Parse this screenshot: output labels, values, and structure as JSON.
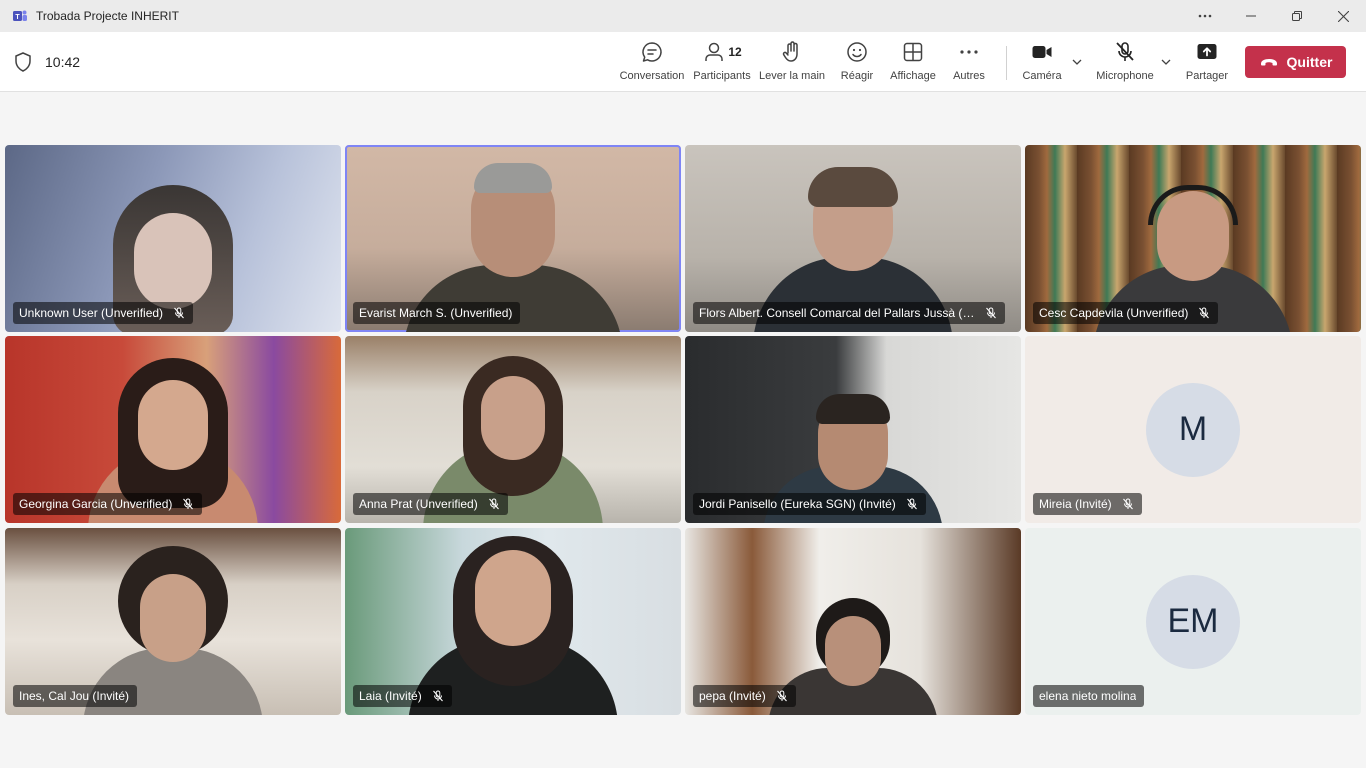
{
  "window": {
    "title": "Trobada Projecte INHERIT",
    "controls": [
      "more",
      "minimize",
      "restore",
      "close"
    ]
  },
  "toolbar": {
    "time": "10:42",
    "buttons": {
      "conversation": "Conversation",
      "participants": "Participants",
      "participants_count": "12",
      "raise_hand": "Lever la main",
      "react": "Réagir",
      "view": "Affichage",
      "more": "Autres",
      "camera": "Caméra",
      "microphone": "Microphone",
      "share": "Partager",
      "leave": "Quitter"
    }
  },
  "colors": {
    "leave_button": "#c4314b",
    "active_speaker_outline": "#7f85f5"
  },
  "participants": [
    {
      "name": "Unknown User (Unverified)",
      "muted": true,
      "video": true,
      "active": false
    },
    {
      "name": "Evarist March S. (Unverified)",
      "muted": false,
      "video": true,
      "active": true
    },
    {
      "name": "Flors Albert. Consell Comarcal del Pallars Jussà (Un...",
      "muted": true,
      "video": true,
      "active": false
    },
    {
      "name": "Cesc Capdevila (Unverified)",
      "muted": true,
      "video": true,
      "active": false
    },
    {
      "name": "Georgina Garcia (Unverified)",
      "muted": true,
      "video": true,
      "active": false
    },
    {
      "name": "Anna Prat (Unverified)",
      "muted": true,
      "video": true,
      "active": false
    },
    {
      "name": "Jordi Panisello (Eureka SGN) (Invité)",
      "muted": true,
      "video": true,
      "active": false
    },
    {
      "name": "Mireia (Invité)",
      "muted": true,
      "video": false,
      "initials": "M",
      "active": false
    },
    {
      "name": "Ines, Cal Jou (Invité)",
      "muted": false,
      "video": true,
      "active": false
    },
    {
      "name": "Laia (Invité)",
      "muted": true,
      "video": true,
      "active": false
    },
    {
      "name": "pepa (Invité)",
      "muted": true,
      "video": true,
      "active": false
    },
    {
      "name": "elena nieto molina",
      "muted": false,
      "video": false,
      "initials": "EM",
      "active": false
    }
  ]
}
